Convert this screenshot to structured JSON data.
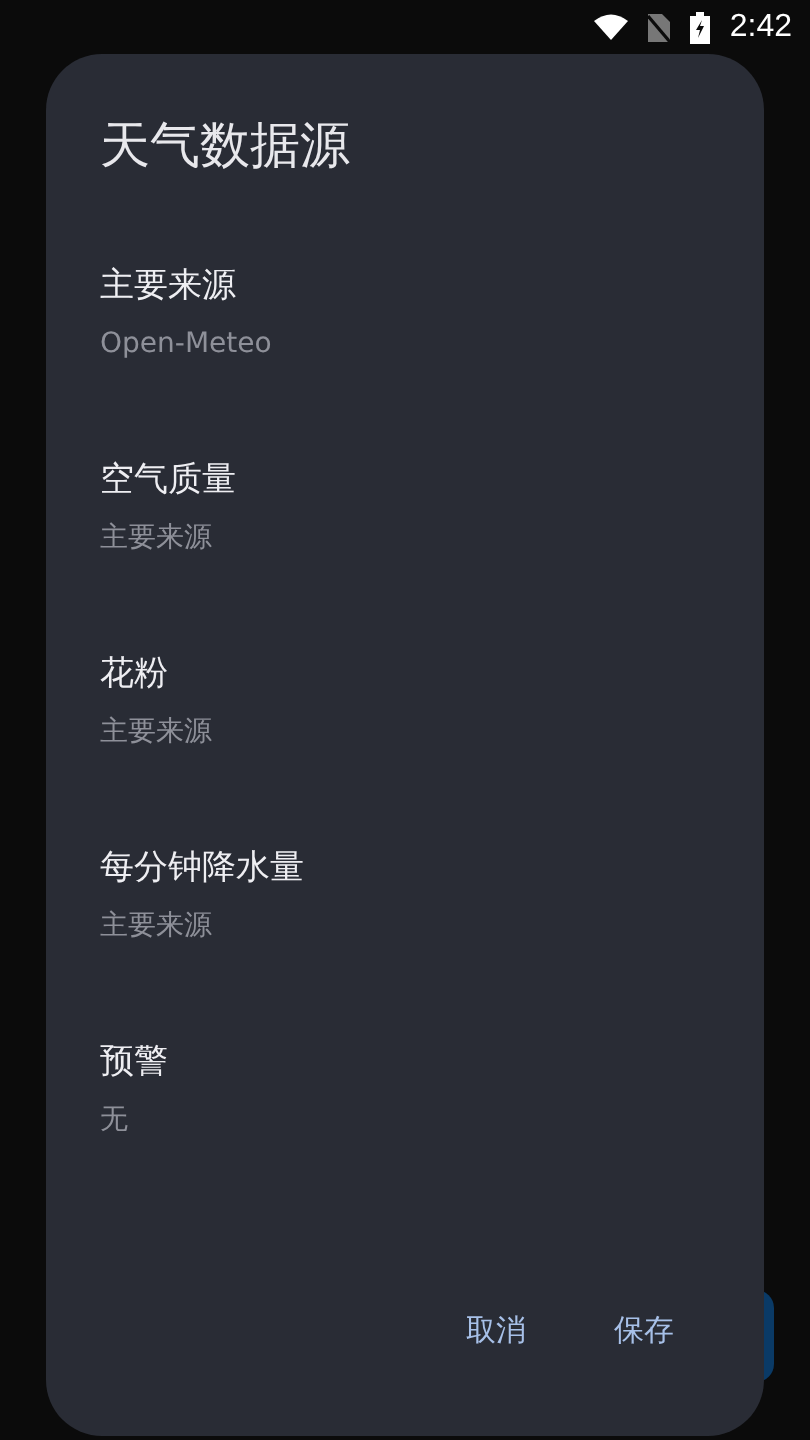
{
  "status_bar": {
    "time": "2:42"
  },
  "dialog": {
    "title": "天气数据源",
    "items": [
      {
        "label": "主要来源",
        "value": "Open-Meteo"
      },
      {
        "label": "空气质量",
        "value": "主要来源"
      },
      {
        "label": "花粉",
        "value": "主要来源"
      },
      {
        "label": "每分钟降水量",
        "value": "主要来源"
      },
      {
        "label": "预警",
        "value": "无"
      }
    ],
    "buttons": [
      "取消",
      "保存"
    ]
  }
}
